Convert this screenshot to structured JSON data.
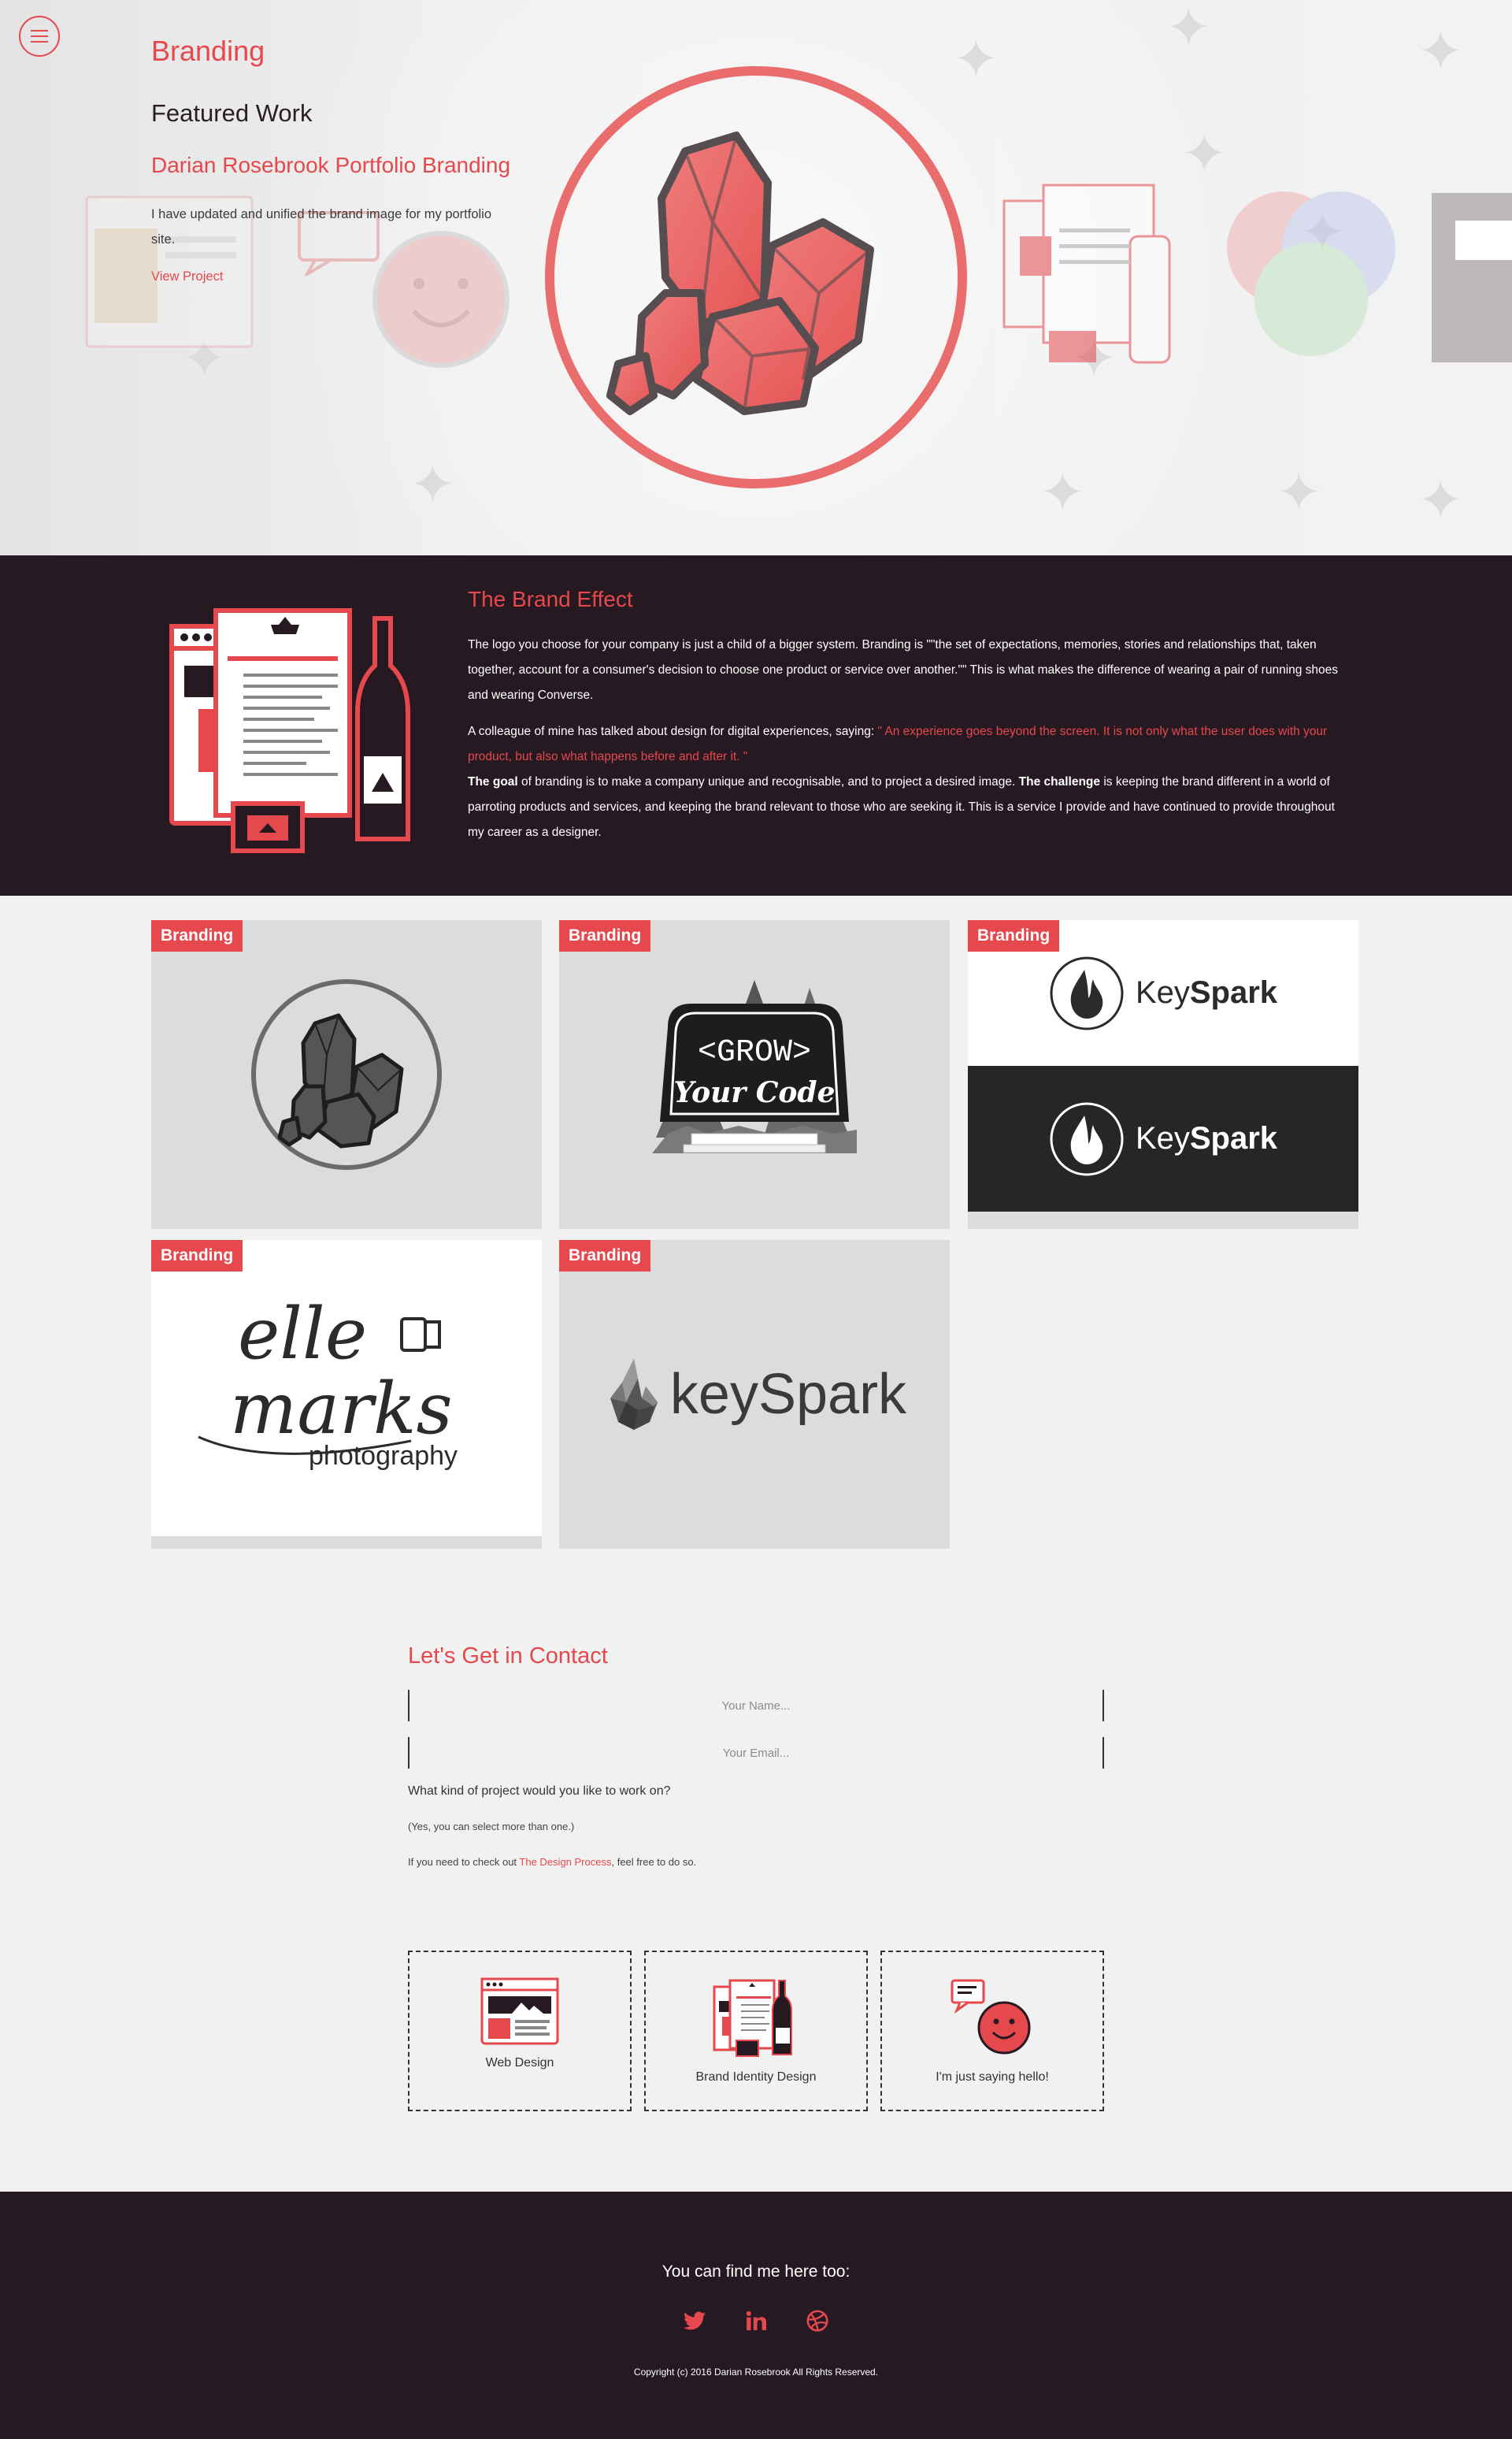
{
  "colors": {
    "accent": "#e5484d",
    "dark": "#261922",
    "light_bg": "#f1f1f1"
  },
  "hero": {
    "category": "Branding",
    "featured": "Featured Work",
    "project_title": "Darian Rosebrook Portfolio Branding",
    "description": "I have updated and unified the brand image for my portfolio site.",
    "link": "View Project"
  },
  "brand_effect": {
    "title": "The Brand Effect",
    "p1_a": "The logo you choose for your company is just a child of a bigger system. Branding is ",
    "p1_b": "\"\"the set of expectations, memories, stories and relationships that, taken together, account for a consumer's decision to choose one product or service over another.\"\"",
    "p1_c": " This is what makes the difference of wearing a pair of running shoes and wearing Converse.",
    "p2_a": "A colleague of mine has talked about design for digital experiences, saying: ",
    "p2_quote": "\" An experience goes beyond the screen. It is not only what the user does with your product, but also what happens before and after it. \"",
    "p3_b1": "The goal",
    "p3_a": " of branding is to make a company unique and recognisable, and to project a desired image. ",
    "p3_b2": "The challenge",
    "p3_c": " is keeping the brand different in a world of parroting products and services, and keeping the brand relevant to those who are seeking it. This is a service I provide and have continued to provide throughout my career as a designer."
  },
  "portfolio": [
    {
      "badge": "Branding"
    },
    {
      "badge": "Branding",
      "sign_line1": "<GROW>",
      "sign_line2": "Your Code"
    },
    {
      "badge": "Branding",
      "logo_light": "Key",
      "logo_bold": "Spark"
    },
    {
      "badge": "Branding",
      "script1": "elle",
      "script2": "marks",
      "sub": "photography"
    },
    {
      "badge": "Branding",
      "logo": "keySpark"
    }
  ],
  "contact": {
    "title": "Let's Get in Contact",
    "name_placeholder": "Your Name...",
    "email_placeholder": "Your Email...",
    "question": "What kind of project would you like to work on?",
    "note": "(Yes, you can select more than one.)",
    "process_pre": "If you need to check out ",
    "process_link": "The Design Process",
    "process_post": ", feel free to do so.",
    "options": [
      "Web Design",
      "Brand Identity Design",
      "I'm just saying hello!"
    ]
  },
  "footer": {
    "title": "You can find me here too:",
    "social_icons": [
      "twitter-icon",
      "linkedin-icon",
      "dribbble-icon"
    ],
    "copyright": "Copyright (c) 2016 Darian Rosebrook All Rights Reserved."
  }
}
